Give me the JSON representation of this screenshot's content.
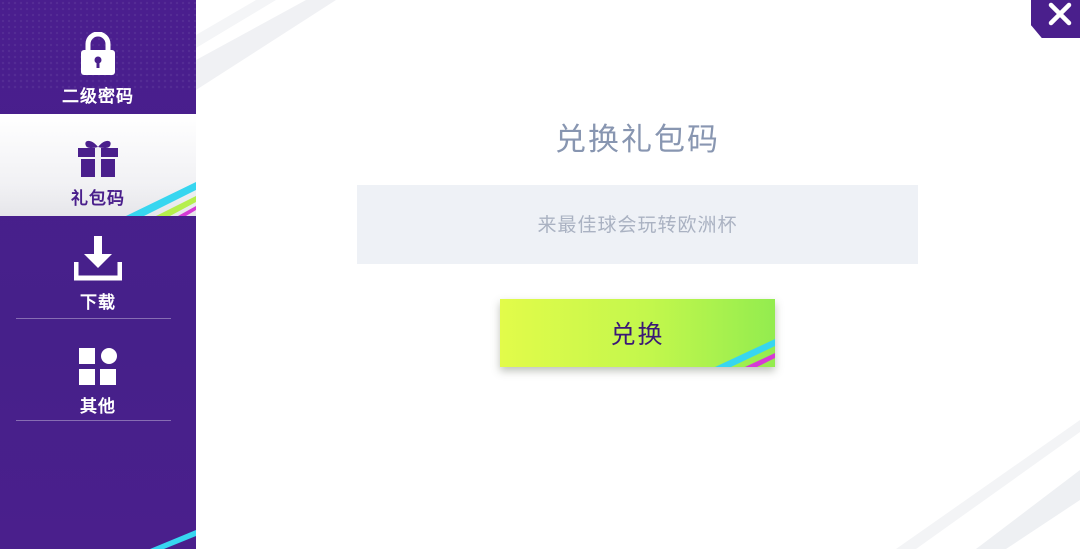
{
  "sidebar": {
    "items": [
      {
        "label": "二级密码",
        "icon": "lock-icon"
      },
      {
        "label": "礼包码",
        "icon": "gift-icon"
      },
      {
        "label": "下载",
        "icon": "download-icon"
      },
      {
        "label": "其他",
        "icon": "grid-icon"
      }
    ],
    "active_index": 1
  },
  "main": {
    "title": "兑换礼包码",
    "input": {
      "value": "",
      "placeholder": "来最佳球会玩转欧洲杯"
    },
    "redeem_label": "兑换"
  },
  "close": {
    "icon": "close-icon"
  },
  "colors": {
    "sidebar_bg": "#4a1f8c",
    "title": "#8896b1",
    "input_bg": "#eef1f6",
    "button_start": "#e2fb4a",
    "button_end": "#93ec4f",
    "button_text": "#3b1877",
    "accent_cyan": "#37d6f0",
    "accent_magenta": "#d63ad6"
  }
}
